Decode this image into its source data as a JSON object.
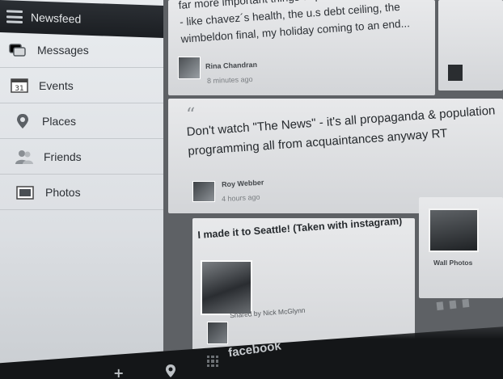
{
  "sidebar": {
    "title": "Newsfeed",
    "items": [
      {
        "label": "Messages",
        "icon": "messages-icon"
      },
      {
        "label": "Events",
        "icon": "calendar-icon"
      },
      {
        "label": "Places",
        "icon": "map-pin-icon"
      },
      {
        "label": "Friends",
        "icon": "friends-icon"
      },
      {
        "label": "Photos",
        "icon": "photos-icon"
      }
    ],
    "calendar_icon_text": "31"
  },
  "feed": {
    "post1": {
      "text": "far more important things to ponder and fret about - like chavez´s health, the u.s debt ceiling, the wimbeldon final, my holiday coming to an end...",
      "author": "Rina Chandran",
      "time": "8 minutes ago"
    },
    "post2": {
      "quote_mark": "“",
      "text": "Don't watch \"The News\" - it's all propaganda & population programming all from acquaintances anyway RT",
      "author": "Roy Webber",
      "time": "4 hours ago"
    },
    "post3": {
      "title": "I made it to Seattle! (Taken with instagram)",
      "shared_by": "Shared by Nick McGlynn"
    },
    "wall_photos": {
      "label": "Wall Photos"
    }
  },
  "bottom_bar": {
    "brand": "facebook",
    "plus_label": "+"
  },
  "colors": {
    "sidebar_bg": "#e3e6e9",
    "header_bg": "#1f2226",
    "card_bg": "#dfe0e2",
    "feed_bg": "#5e6165"
  }
}
